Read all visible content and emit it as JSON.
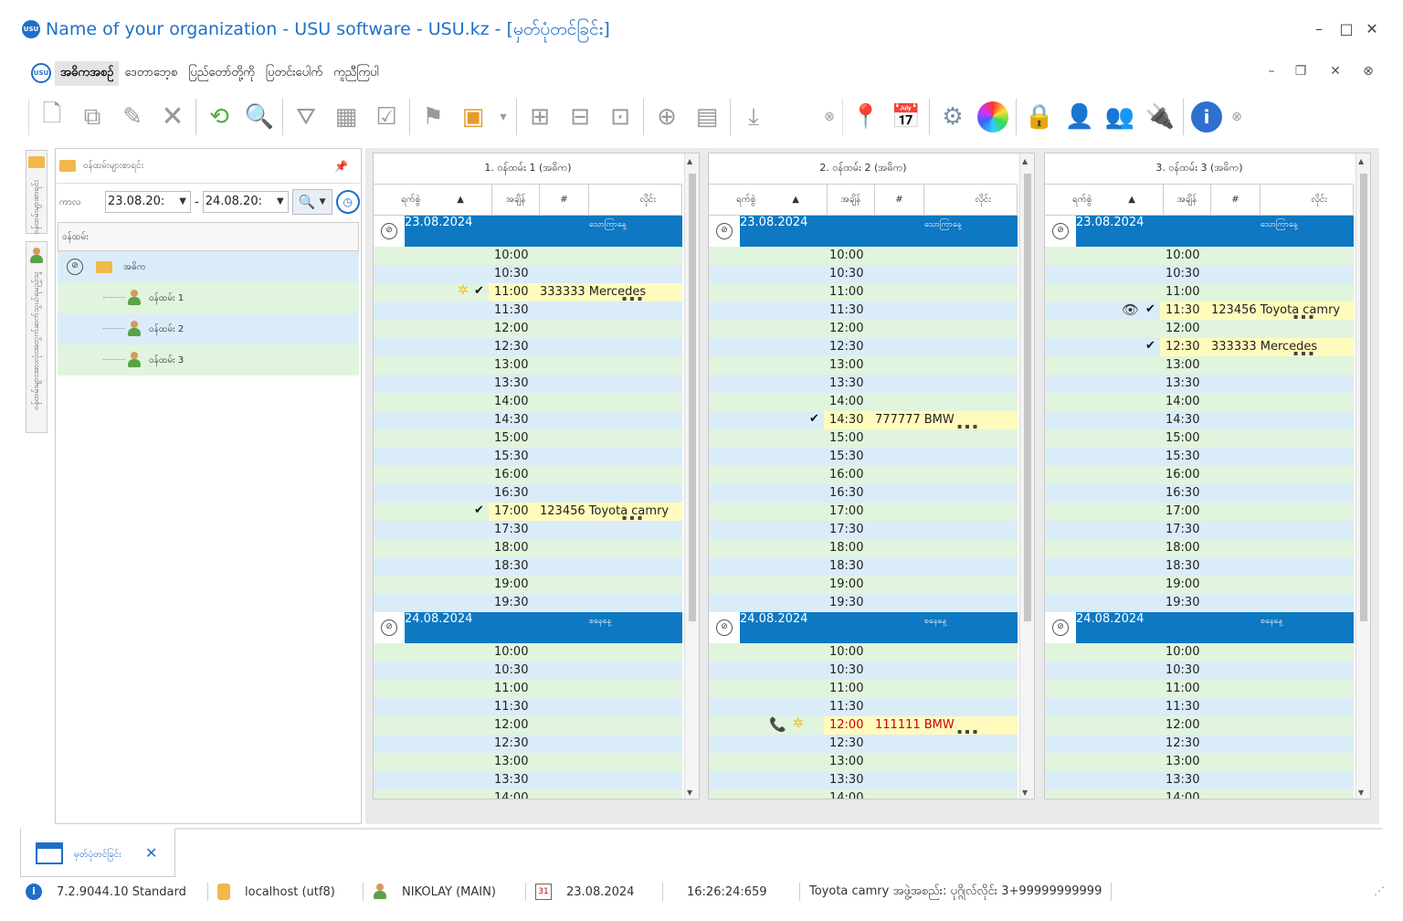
{
  "window": {
    "logo_text": "USU",
    "title": "Name of your organization - USU software - USU.kz - [မှတ်ပုံတင်ခြင်း]",
    "minimize": "–",
    "maximize": "□",
    "close": "✕"
  },
  "menu": {
    "logo_text": "USU",
    "items": [
      "အဓိကအစဉ်",
      "ဒေတာဘေ့စ",
      "ပြည်တော်တို့ကို",
      "ပြတင်းပေါက်",
      "ကူညီကြပါ"
    ],
    "mdi_minimize": "–",
    "mdi_restore": "❐",
    "mdi_close": "✕"
  },
  "toolbar": {
    "icons": [
      "add-record-icon",
      "copy-icon",
      "edit-icon",
      "delete-icon",
      "refresh-icon",
      "search-icon",
      "filter-icon",
      "filter-columns-icon",
      "filter-check-icon",
      "flag-icon",
      "image-icon",
      "expand-icon",
      "tree-expand-icon",
      "tree-collapse-icon",
      "add-column-icon",
      "report-icon",
      "download-icon",
      "location-icon",
      "calendar-icon",
      "settings-icon",
      "color-wheel-icon",
      "lock-icon",
      "user-key-icon",
      "users-icon",
      "plugin-icon",
      "info-icon"
    ]
  },
  "side_tabs": [
    "ဝန်ထမ်းများစာရင်း",
    "ဝန်ထမ်းများအားလုံးအတွက်ဆက်သွယ်ရမည့်သူ"
  ],
  "left_panel": {
    "header": "ဝန်ထမ်းများစာရင်း",
    "pin": "📌",
    "period_label": "ကာလ",
    "date_from": "23.08.20:",
    "date_to": "24.08.20:",
    "dash": "-",
    "tree_header": "ဝန်ထမ်း",
    "tree": {
      "root": "အဓိက",
      "children": [
        "ဝန်ထမ်း 1",
        "ဝန်ထမ်း 2",
        "ဝန်ထမ်း 3"
      ]
    }
  },
  "columns_headers": {
    "visit": "ရက်စွဲ",
    "time": "အချိန်",
    "number": "#",
    "car": "လိုင်း"
  },
  "schedule": [
    {
      "title": "1. ဝန်ထမ်း 1 (အဓိက)",
      "days": [
        {
          "date": "23.08.2024",
          "weekday": "သောကြာနေ့",
          "slots": [
            {
              "time": "10:00"
            },
            {
              "time": "10:30"
            },
            {
              "time": "11:00",
              "appt": "333333  Mercedes",
              "check": "✔",
              "star": "✲"
            },
            {
              "time": "11:30"
            },
            {
              "time": "12:00"
            },
            {
              "time": "12:30"
            },
            {
              "time": "13:00"
            },
            {
              "time": "13:30"
            },
            {
              "time": "14:00"
            },
            {
              "time": "14:30"
            },
            {
              "time": "15:00"
            },
            {
              "time": "15:30"
            },
            {
              "time": "16:00"
            },
            {
              "time": "16:30"
            },
            {
              "time": "17:00",
              "appt": "123456  Toyota camry",
              "check": "✔"
            },
            {
              "time": "17:30"
            },
            {
              "time": "18:00"
            },
            {
              "time": "18:30"
            },
            {
              "time": "19:00"
            },
            {
              "time": "19:30"
            }
          ]
        },
        {
          "date": "24.08.2024",
          "weekday": "စနေနေ့",
          "slots": [
            {
              "time": "10:00"
            },
            {
              "time": "10:30"
            },
            {
              "time": "11:00"
            },
            {
              "time": "11:30"
            },
            {
              "time": "12:00"
            },
            {
              "time": "12:30"
            },
            {
              "time": "13:00"
            },
            {
              "time": "13:30"
            },
            {
              "time": "14:00"
            }
          ]
        }
      ]
    },
    {
      "title": "2. ဝန်ထမ်း 2 (အဓိက)",
      "days": [
        {
          "date": "23.08.2024",
          "weekday": "သောကြာနေ့",
          "slots": [
            {
              "time": "10:00"
            },
            {
              "time": "10:30"
            },
            {
              "time": "11:00"
            },
            {
              "time": "11:30"
            },
            {
              "time": "12:00"
            },
            {
              "time": "12:30"
            },
            {
              "time": "13:00"
            },
            {
              "time": "13:30"
            },
            {
              "time": "14:00"
            },
            {
              "time": "14:30",
              "appt": "777777  BMW",
              "check": "✔"
            },
            {
              "time": "15:00"
            },
            {
              "time": "15:30"
            },
            {
              "time": "16:00"
            },
            {
              "time": "16:30"
            },
            {
              "time": "17:00"
            },
            {
              "time": "17:30"
            },
            {
              "time": "18:00"
            },
            {
              "time": "18:30"
            },
            {
              "time": "19:00"
            },
            {
              "time": "19:30"
            }
          ]
        },
        {
          "date": "24.08.2024",
          "weekday": "စနေနေ့",
          "slots": [
            {
              "time": "10:00"
            },
            {
              "time": "10:30"
            },
            {
              "time": "11:00"
            },
            {
              "time": "11:30"
            },
            {
              "time": "12:00",
              "appt": "111111  BMW",
              "red": true,
              "phone": "📞",
              "star": "✲"
            },
            {
              "time": "12:30"
            },
            {
              "time": "13:00"
            },
            {
              "time": "13:30"
            },
            {
              "time": "14:00"
            }
          ]
        }
      ]
    },
    {
      "title": "3. ဝန်ထမ်း 3 (အဓိက)",
      "days": [
        {
          "date": "23.08.2024",
          "weekday": "သောကြာနေ့",
          "slots": [
            {
              "time": "10:00"
            },
            {
              "time": "10:30"
            },
            {
              "time": "11:00"
            },
            {
              "time": "11:30",
              "appt": "123456  Toyota camry",
              "check": "✔",
              "eye": "👁"
            },
            {
              "time": "12:00"
            },
            {
              "time": "12:30",
              "appt": "333333  Mercedes",
              "check": "✔"
            },
            {
              "time": "13:00"
            },
            {
              "time": "13:30"
            },
            {
              "time": "14:00"
            },
            {
              "time": "14:30"
            },
            {
              "time": "15:00"
            },
            {
              "time": "15:30"
            },
            {
              "time": "16:00"
            },
            {
              "time": "16:30"
            },
            {
              "time": "17:00"
            },
            {
              "time": "17:30"
            },
            {
              "time": "18:00"
            },
            {
              "time": "18:30"
            },
            {
              "time": "19:00"
            },
            {
              "time": "19:30"
            }
          ]
        },
        {
          "date": "24.08.2024",
          "weekday": "စနေနေ့",
          "slots": [
            {
              "time": "10:00"
            },
            {
              "time": "10:30"
            },
            {
              "time": "11:00"
            },
            {
              "time": "11:30"
            },
            {
              "time": "12:00"
            },
            {
              "time": "12:30"
            },
            {
              "time": "13:00"
            },
            {
              "time": "13:30"
            },
            {
              "time": "14:00"
            }
          ]
        }
      ]
    }
  ],
  "bottom_tab": {
    "label": "မှတ်ပုံတင်ခြင်း",
    "close": "✕"
  },
  "status": {
    "version": "7.2.9044.10 Standard",
    "db": "localhost (utf8)",
    "user": "NIKOLAY (MAIN)",
    "cal_icon_text": "31",
    "date": "23.08.2024",
    "time": "16:26:24:659",
    "info": "Toyota camry အဖွဲ့အစည်း: ပုဂ္ဂိုလ်လိုင်း 3+99999999999"
  },
  "colors": {
    "accent": "#1e6fc8",
    "day_band": "#0e78c2",
    "row_blue": "#dbecf9",
    "row_green": "#e1f4dd",
    "highlight": "#fffbbd"
  }
}
